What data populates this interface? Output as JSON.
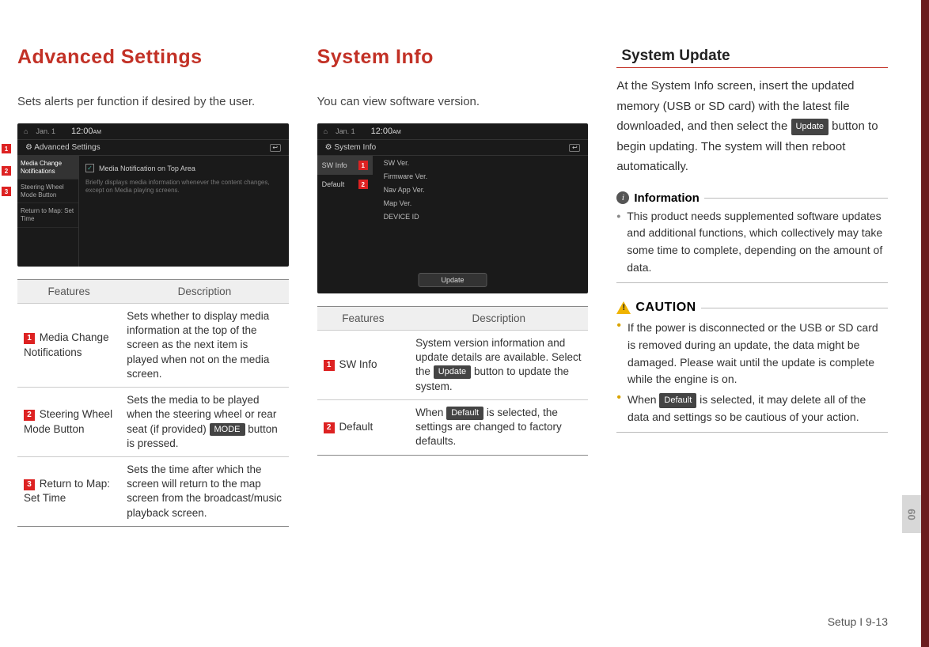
{
  "sidebar_tab": "09",
  "footer": "Setup I 9-13",
  "col1": {
    "heading": "Advanced Settings",
    "intro": "Sets alerts per function if desired by the user.",
    "shot": {
      "date": "Jan. 1",
      "time": "12:00",
      "ampm": "AM",
      "title": "Advanced Settings",
      "side1": "Media Change Notifications",
      "side2": "Steering Wheel Mode Button",
      "side3": "Return to Map: Set Time",
      "check_label": "Media Notification on Top Area",
      "desc": "Briefly displays media information whenever the content changes, except on Media playing screens."
    },
    "table": {
      "h1": "Features",
      "h2": "Description",
      "r1f": "Media Change Notifications",
      "r1d": "Sets whether to display media information at the top of the screen as the next item is played when not on the media screen.",
      "r2f": "Steering Wheel Mode Button",
      "r2d_a": "Sets the media to be played when the steering wheel or rear seat (if provided) ",
      "r2d_chip": "MODE",
      "r2d_b": " button is pressed.",
      "r3f": "Return to Map: Set Time",
      "r3d": "Sets the time after which the screen will return to the map screen from the broadcast/music playback screen."
    }
  },
  "col2": {
    "heading": "System Info",
    "intro": "You can view software version.",
    "shot": {
      "date": "Jan. 1",
      "time": "12:00",
      "ampm": "AM",
      "title": "System Info",
      "tab1": "SW Info",
      "tab2": "Default",
      "line1": "SW Ver.",
      "line2": "Firmware Ver.",
      "line3": "Nav App Ver.",
      "line4": "Map Ver.",
      "line5": "DEVICE ID",
      "update": "Update"
    },
    "table": {
      "h1": "Features",
      "h2": "Description",
      "r1f": "SW Info",
      "r1d_a": "System version information and update details are available. Select the ",
      "r1d_chip": "Update",
      "r1d_b": " button to update the system.",
      "r2f": "Default",
      "r2d_a": "When ",
      "r2d_chip": "Default",
      "r2d_b": " is selected, the settings are changed to factory defaults."
    }
  },
  "col3": {
    "subhead": "System Update",
    "body_a": "At the System Info screen, insert the updated memory (USB or SD card) with the latest file downloaded, and then select the ",
    "body_chip": "Update",
    "body_b": " button to begin updating. The system will then reboot automatically.",
    "info_title": "Information",
    "info_bullet": "This product needs supplemented software updates and additional functions, which collectively may take some time to complete, depending on the amount of data.",
    "caution_title": "CAUTION",
    "caution1": "If the power is disconnected or the USB or SD card is removed during an update, the data might be damaged. Please wait until the update is complete while the engine is on.",
    "caution2_a": "When ",
    "caution2_chip": "Default",
    "caution2_b": " is selected, it may delete all of the data and settings so be cautious of your action."
  }
}
